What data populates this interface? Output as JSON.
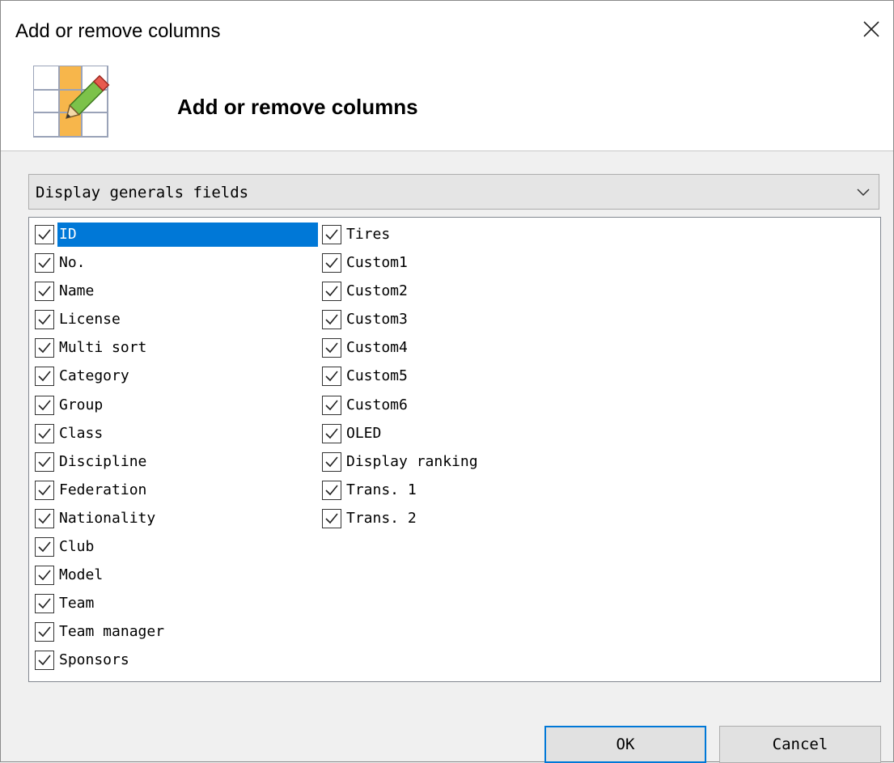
{
  "window": {
    "title": "Add or remove columns"
  },
  "header": {
    "title": "Add or remove columns",
    "icon": "table-edit-icon"
  },
  "dropdown": {
    "selected": "Display generals fields"
  },
  "columns_left": [
    {
      "label": "ID",
      "checked": true,
      "selected": true
    },
    {
      "label": "No.",
      "checked": true
    },
    {
      "label": "Name",
      "checked": true
    },
    {
      "label": "License",
      "checked": true
    },
    {
      "label": "Multi sort",
      "checked": true
    },
    {
      "label": "Category",
      "checked": true
    },
    {
      "label": "Group",
      "checked": true
    },
    {
      "label": "Class",
      "checked": true
    },
    {
      "label": "Discipline",
      "checked": true
    },
    {
      "label": "Federation",
      "checked": true
    },
    {
      "label": "Nationality",
      "checked": true
    },
    {
      "label": "Club",
      "checked": true
    },
    {
      "label": "Model",
      "checked": true
    },
    {
      "label": "Team",
      "checked": true
    },
    {
      "label": "Team manager",
      "checked": true
    },
    {
      "label": "Sponsors",
      "checked": true
    }
  ],
  "columns_right": [
    {
      "label": "Tires",
      "checked": true
    },
    {
      "label": "Custom1",
      "checked": true
    },
    {
      "label": "Custom2",
      "checked": true
    },
    {
      "label": "Custom3",
      "checked": true
    },
    {
      "label": "Custom4",
      "checked": true
    },
    {
      "label": "Custom5",
      "checked": true
    },
    {
      "label": "Custom6",
      "checked": true
    },
    {
      "label": "OLED",
      "checked": true
    },
    {
      "label": "Display ranking",
      "checked": true
    },
    {
      "label": "Trans. 1",
      "checked": true
    },
    {
      "label": "Trans. 2",
      "checked": true
    }
  ],
  "buttons": {
    "ok": "OK",
    "cancel": "Cancel"
  },
  "colors": {
    "selection": "#0078d7",
    "dialog_bg": "#f0f0f0",
    "button_bg": "#e1e1e1"
  }
}
